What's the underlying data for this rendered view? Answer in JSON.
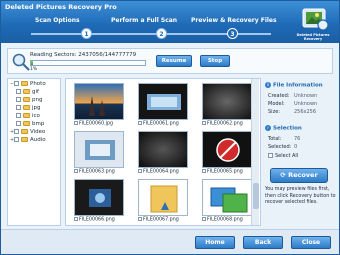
{
  "app": {
    "title": "Deleted Pictures Recovery Pro",
    "logo_text": "Deleted Pictures Recovery"
  },
  "steps": [
    {
      "num": "1",
      "label": "Scan Options"
    },
    {
      "num": "2",
      "label": "Perform a Full Scan"
    },
    {
      "num": "3",
      "label": "Preview & Recovery Files"
    }
  ],
  "scan": {
    "reading_text": "Reading Sectors: 2437056/144777779",
    "percent_text": "1%",
    "progress": 0.01,
    "resume_label": "Resume",
    "stop_label": "Stop"
  },
  "tree": [
    {
      "label": "Photo",
      "level": 0,
      "twisty": "−"
    },
    {
      "label": "gif",
      "level": 1
    },
    {
      "label": "png",
      "level": 1
    },
    {
      "label": "jpg",
      "level": 1
    },
    {
      "label": "ico",
      "level": 1
    },
    {
      "label": "bmp",
      "level": 1
    },
    {
      "label": "Video",
      "level": 0,
      "twisty": "+"
    },
    {
      "label": "Audio",
      "level": 0,
      "twisty": "+"
    }
  ],
  "files": [
    "FILE00060.jpg",
    "FILE00061.png",
    "FILE00062.png",
    "FILE00063.png",
    "FILE00064.png",
    "FILE00065.png",
    "FILE00066.png",
    "FILE00067.png",
    "FILE00068.png"
  ],
  "file_info": {
    "heading": "File Information",
    "created_label": "Created:",
    "created_value": "Unknown",
    "model_label": "Model:",
    "model_value": "Unknown",
    "size_label": "Size:",
    "size_value": "256x256"
  },
  "selection": {
    "heading": "Selection",
    "total_label": "Total:",
    "total_value": "76",
    "selected_label": "Selected:",
    "selected_value": "0",
    "select_all_label": "Select All"
  },
  "recover_label": "Recover",
  "hint_text": "You may preview files first, then click Recovery button to recover selected files.",
  "bottom": {
    "home_label": "Home",
    "back_label": "Back",
    "close_label": "Close"
  },
  "colors": {
    "accent": "#2d7cc8",
    "title_bar": "#1e68b4",
    "progress": "#3ea32a"
  }
}
